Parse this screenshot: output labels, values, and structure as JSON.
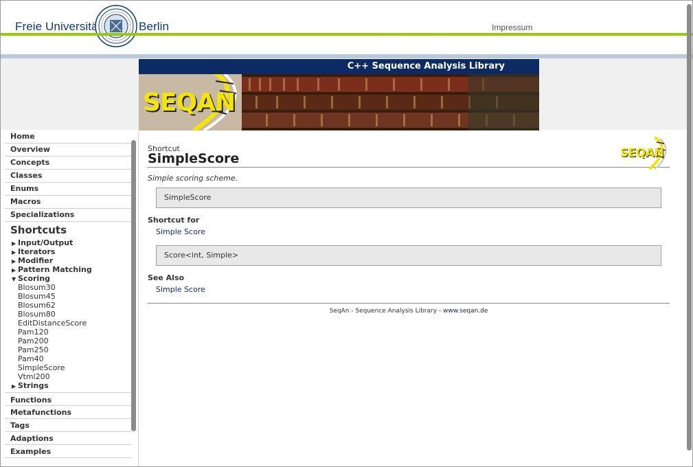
{
  "header": {
    "university_left": "Freie Universität",
    "university_right": "Berlin",
    "impressum_label": "Impressum"
  },
  "banner": {
    "tagline": "C++ Sequence Analysis Library",
    "logo_text": "SEQAN"
  },
  "sidebar": {
    "items_top": [
      "Home",
      "Overview",
      "Concepts",
      "Classes",
      "Enums",
      "Macros",
      "Specializations"
    ],
    "heading": "Shortcuts",
    "tree": [
      {
        "label": "Input/Output",
        "expanded": false
      },
      {
        "label": "Iterators",
        "expanded": false
      },
      {
        "label": "Modifier",
        "expanded": false
      },
      {
        "label": "Pattern Matching",
        "expanded": false
      },
      {
        "label": "Scoring",
        "expanded": true
      }
    ],
    "scoring_children": [
      "Blosum30",
      "Blosum45",
      "Blosum62",
      "Blosum80",
      "EditDistanceScore",
      "Pam120",
      "Pam200",
      "Pam250",
      "Pam40",
      "SimpleScore",
      "Vtml200"
    ],
    "tree_after": {
      "label": "Strings",
      "expanded": false
    },
    "items_bottom": [
      "Functions",
      "Metafunctions",
      "Tags",
      "Adaptions",
      "Examples"
    ]
  },
  "content": {
    "kind": "Shortcut",
    "title": "SimpleScore",
    "logo_text": "SEQAN",
    "summary": "Simple scoring scheme.",
    "signature": "SimpleScore",
    "shortcut_for_heading": "Shortcut for",
    "shortcut_for_link": "Simple Score",
    "shortcut_for_code": "Score<int, Simple>",
    "see_also_heading": "See Also",
    "see_also_link": "Simple Score"
  },
  "footer": {
    "text": "SeqAn - Sequence Analysis Library - ",
    "link": "www.seqan.de"
  },
  "colors": {
    "fu_blue": "#0b3b7a",
    "green_line": "#99cc00",
    "banner_navy": "#0c2a63",
    "logo_yellow": "#f2e600",
    "link": "#1a237e"
  }
}
